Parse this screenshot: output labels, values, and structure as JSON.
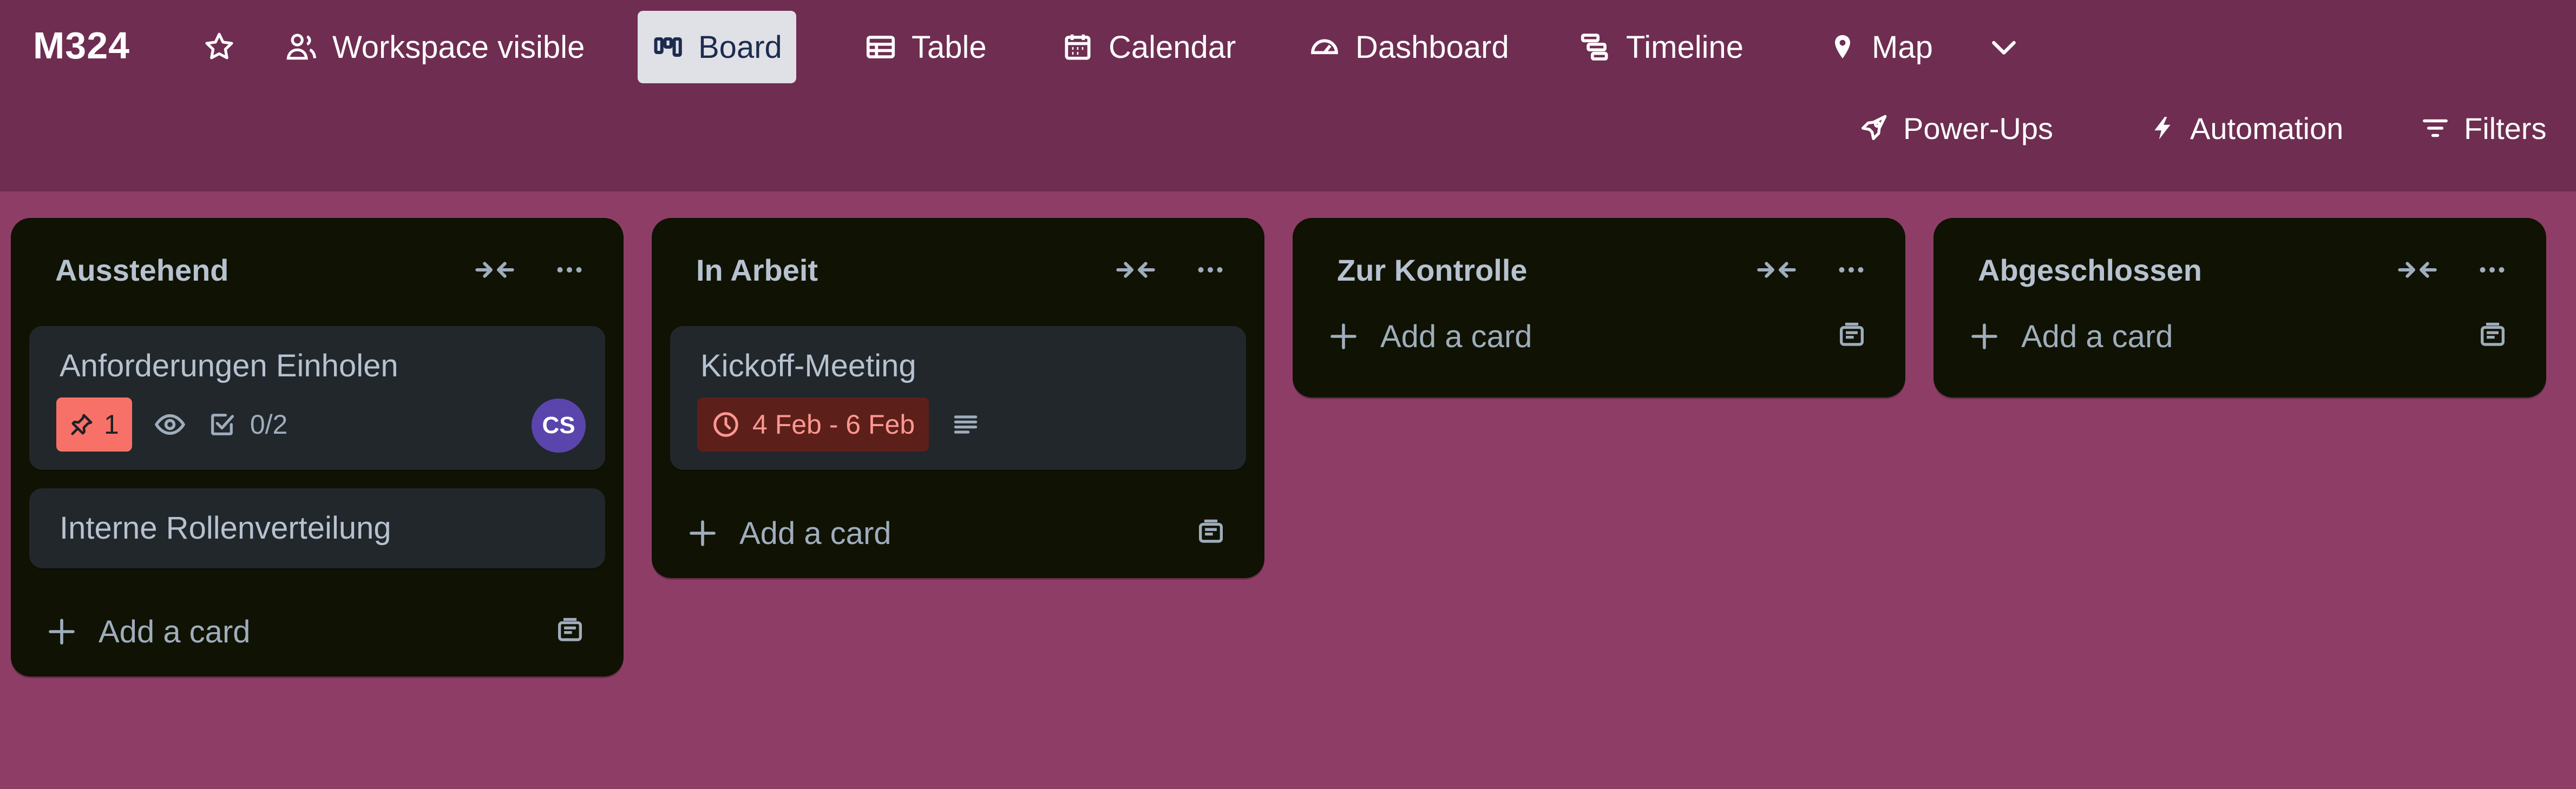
{
  "header": {
    "board_title": "M324",
    "visibility_label": "Workspace visible",
    "views": [
      {
        "label": "Board",
        "icon": "board-icon",
        "active": true
      },
      {
        "label": "Table",
        "icon": "table-icon",
        "active": false
      },
      {
        "label": "Calendar",
        "icon": "calendar-icon",
        "active": false
      },
      {
        "label": "Dashboard",
        "icon": "dashboard-icon",
        "active": false
      },
      {
        "label": "Timeline",
        "icon": "timeline-icon",
        "active": false
      },
      {
        "label": "Map",
        "icon": "map-pin-icon",
        "active": false
      }
    ],
    "actions": {
      "powerups_label": "Power-Ups",
      "automation_label": "Automation",
      "filters_label": "Filters"
    }
  },
  "lists": [
    {
      "title": "Ausstehend",
      "cards": [
        {
          "title": "Anforderungen Einholen",
          "notification_count": "1",
          "watching": true,
          "checklist": "0/2",
          "member_initials": "CS"
        },
        {
          "title": "Interne Rollenverteilung"
        }
      ],
      "add_card_label": "Add a card"
    },
    {
      "title": "In Arbeit",
      "cards": [
        {
          "title": "Kickoff-Meeting",
          "due_date": "4 Feb - 6 Feb",
          "has_description": true
        }
      ],
      "add_card_label": "Add a card"
    },
    {
      "title": "Zur Kontrolle",
      "cards": [],
      "add_card_label": "Add a card"
    },
    {
      "title": "Abgeschlossen",
      "cards": [],
      "add_card_label": "Add a card"
    }
  ],
  "colors": {
    "header_bg": "#6e2d51",
    "board_bg": "#8e3e66",
    "list_bg": "#101204",
    "card_bg": "#22272b",
    "notification_badge": "#f87168",
    "overdue_badge_bg": "#5d1f1a",
    "avatar": "#5a45ad"
  }
}
